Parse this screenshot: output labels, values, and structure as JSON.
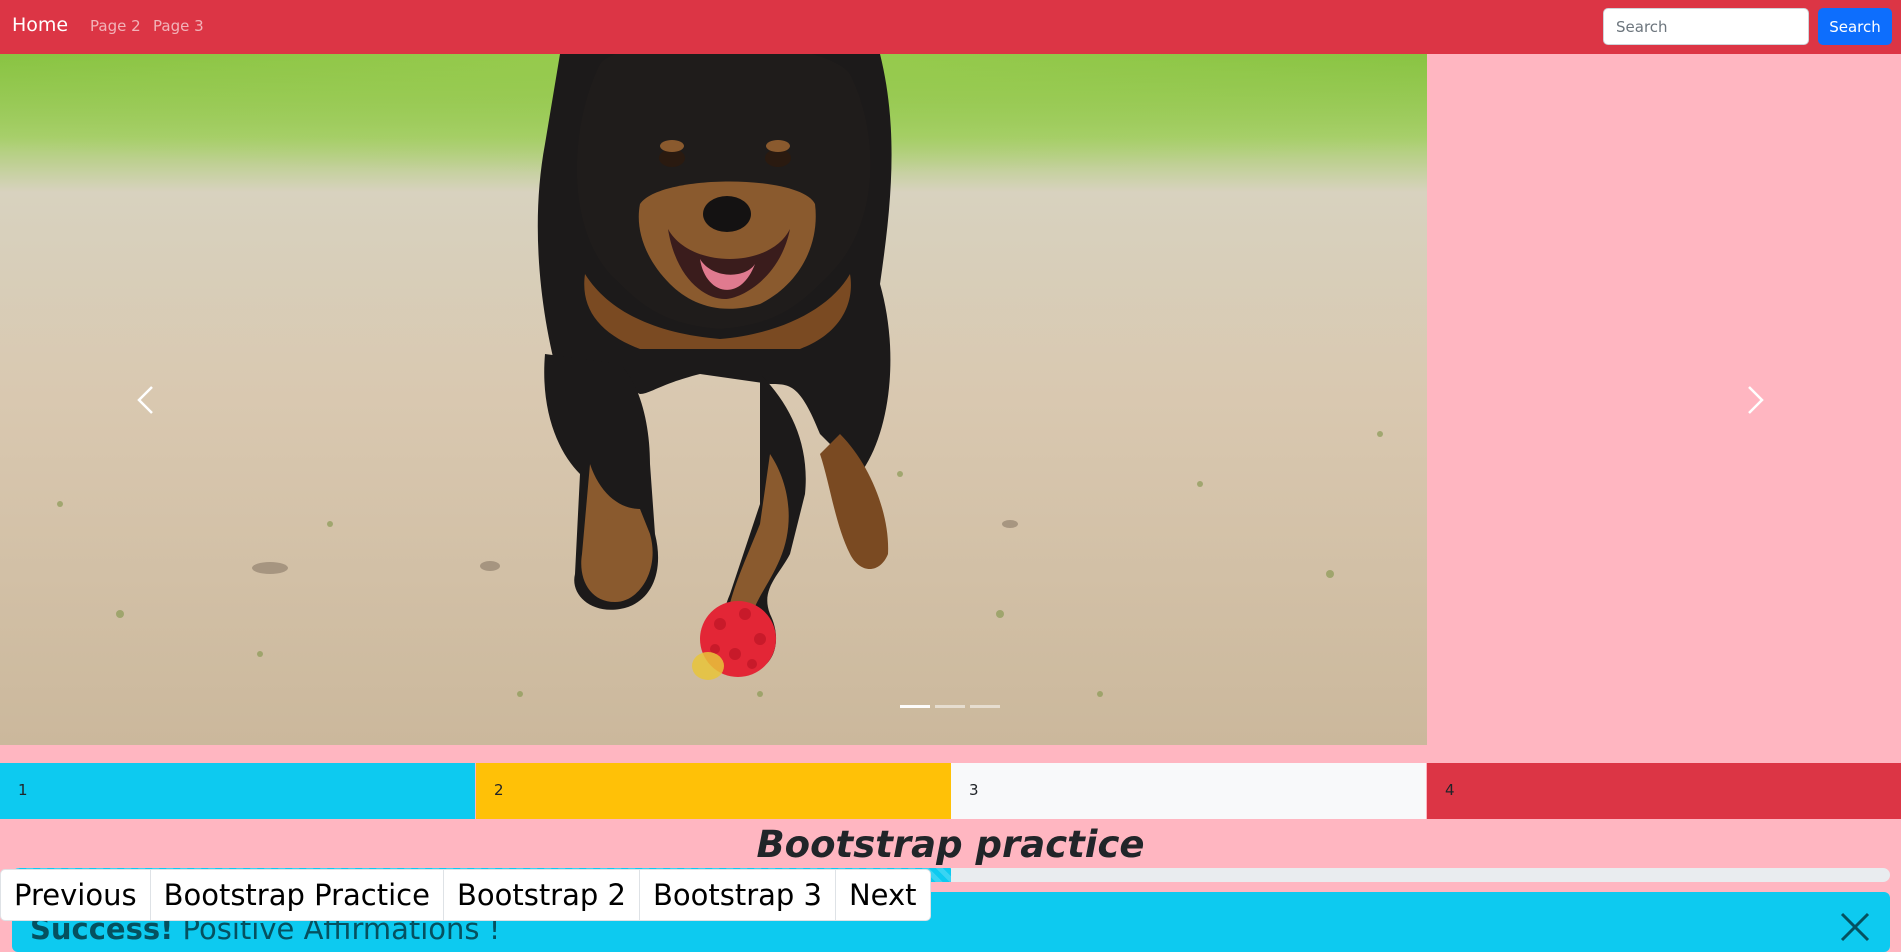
{
  "navbar": {
    "brand": "Home",
    "links": [
      "Page 2",
      "Page 3"
    ],
    "search_placeholder": "Search",
    "search_button": "Search",
    "bg_color": "#dc3545"
  },
  "carousel": {
    "image": "dog-running-photo",
    "prev_icon": "chevron-left-icon",
    "next_icon": "chevron-right-icon",
    "indicator_count": 3,
    "active_index": 0
  },
  "columns": [
    {
      "label": "1",
      "color": "#0dcaf0"
    },
    {
      "label": "2",
      "color": "#ffc107"
    },
    {
      "label": "3",
      "color": "#f8f9fa"
    },
    {
      "label": "4",
      "color": "#dc3545"
    }
  ],
  "heading": "Bootstrap practice",
  "progress": {
    "fraction": 0.5,
    "color": "#0dcaf0",
    "striped": true
  },
  "alert": {
    "strong": "Success!",
    "text": " Positive Affirmations !",
    "close_icon": "close-icon"
  },
  "pagination": {
    "previous": "Previous",
    "pages": [
      "Bootstrap Practice",
      "Bootstrap 2",
      "Bootstrap 3"
    ],
    "next": "Next"
  },
  "page_bg": "#ffb6c1"
}
